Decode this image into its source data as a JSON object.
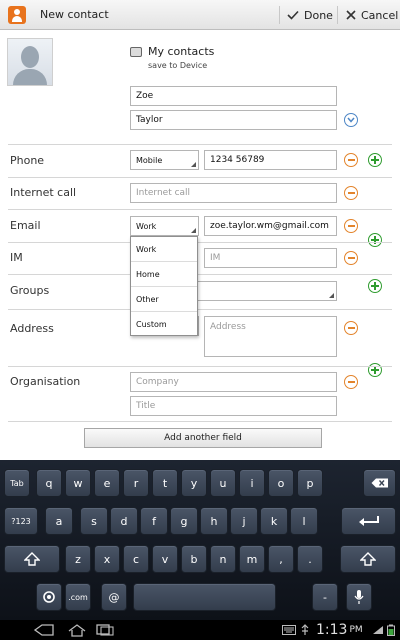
{
  "action_bar": {
    "title": "New contact",
    "done_label": "Done",
    "cancel_label": "Cancel"
  },
  "account": {
    "name": "My contacts",
    "subtitle": "save to Device"
  },
  "name": {
    "first_value": "Zoe",
    "last_value": "Taylor"
  },
  "sections": {
    "phone_label": "Phone",
    "phone_type": "Mobile",
    "phone_value": "1234 56789",
    "internet_call_label": "Internet call",
    "internet_call_placeholder": "Internet call",
    "email_label": "Email",
    "email_type": "Work",
    "email_value": "zoe.taylor.wm@gmail.com",
    "im_label": "IM",
    "im_placeholder": "IM",
    "groups_label": "Groups",
    "address_label": "Address",
    "address_placeholder": "Address",
    "organisation_label": "Organisation",
    "company_placeholder": "Company",
    "title_placeholder": "Title"
  },
  "dropdown_options": [
    "Work",
    "Home",
    "Other",
    "Custom"
  ],
  "add_field_label": "Add another field",
  "keyboard": {
    "row1": [
      "Tab",
      "q",
      "w",
      "e",
      "r",
      "t",
      "y",
      "u",
      "i",
      "o",
      "p"
    ],
    "row2": [
      "?123",
      "a",
      "s",
      "d",
      "f",
      "g",
      "h",
      "j",
      "k",
      "l"
    ],
    "row3": [
      "z",
      "x",
      "c",
      "v",
      "b",
      "n",
      "m",
      ",",
      "."
    ],
    "row4_com": ".com",
    "row4_at": "@",
    "row4_dash": "-"
  },
  "system_bar": {
    "time": "1:13",
    "ampm": "PM"
  },
  "colors": {
    "accent_orange": "#e3842b",
    "accent_green": "#2f9c2f",
    "expand_blue": "#4d86c6",
    "keyboard_bg": "#141a24"
  }
}
